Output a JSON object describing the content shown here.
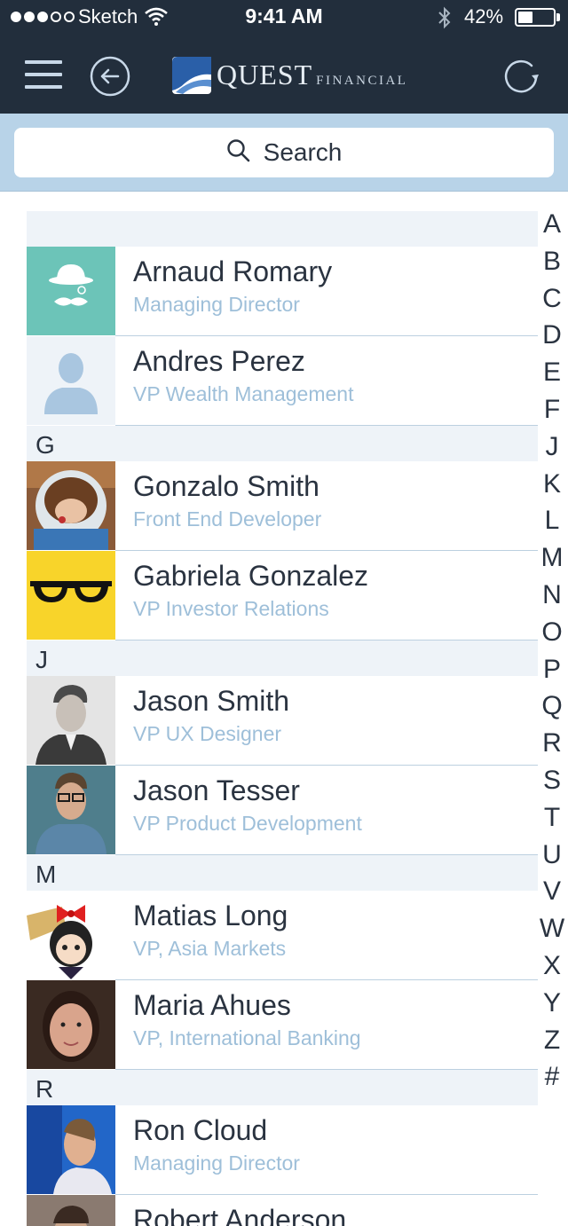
{
  "status_bar": {
    "carrier": "Sketch",
    "time": "9:41 AM",
    "battery_percent": "42%",
    "battery_level": 0.42,
    "signal_bars": 3,
    "signal_total": 5
  },
  "navbar": {
    "brand_name": "QUEST",
    "brand_suffix": "FINANCIAL",
    "menu_icon": "hamburger-menu-icon",
    "back_icon": "back-arrow-circle-icon",
    "refresh_icon": "refresh-icon"
  },
  "search": {
    "label": "Search",
    "icon": "search-icon"
  },
  "colors": {
    "topbar": "#222e3c",
    "search_band": "#b8d3e8",
    "section_header": "#eef3f8",
    "subtitle": "#9ebfd9",
    "text": "#2a3340"
  },
  "contacts": {
    "sections": [
      {
        "letter": "",
        "rows": [
          {
            "name": "Arnaud Romary",
            "title": "Managing Director",
            "avatar": "bowler-hat-mustache-avatar"
          },
          {
            "name": "Andres Perez",
            "title": "VP Wealth Management",
            "avatar": "default-person-avatar"
          }
        ]
      },
      {
        "letter": "G",
        "rows": [
          {
            "name": "Gonzalo Smith",
            "title": "Front End Developer",
            "avatar": "astronaut-helmet-photo"
          },
          {
            "name": "Gabriela Gonzalez",
            "title": "VP Investor Relations",
            "avatar": "black-glasses-avatar"
          }
        ]
      },
      {
        "letter": "J",
        "rows": [
          {
            "name": "Jason Smith",
            "title": "VP UX Designer",
            "avatar": "man-in-suit-photo"
          },
          {
            "name": "Jason Tesser",
            "title": "VP Product Development",
            "avatar": "man-with-glasses-photo"
          }
        ]
      },
      {
        "letter": "M",
        "rows": [
          {
            "name": "Matias Long",
            "title": "VP, Asia Markets",
            "avatar": "anime-girl-red-bow-avatar"
          },
          {
            "name": "Maria Ahues",
            "title": "VP, International Banking",
            "avatar": "woman-portrait-photo"
          }
        ]
      },
      {
        "letter": "R",
        "rows": [
          {
            "name": "Ron Cloud",
            "title": "Managing Director",
            "avatar": "man-speaking-photo"
          },
          {
            "name": "Robert Anderson",
            "title": "",
            "avatar": "man-portrait-photo"
          }
        ]
      }
    ]
  },
  "index_letters": [
    "A",
    "B",
    "C",
    "D",
    "E",
    "F",
    "J",
    "K",
    "L",
    "M",
    "N",
    "O",
    "P",
    "Q",
    "R",
    "S",
    "T",
    "U",
    "V",
    "W",
    "X",
    "Y",
    "Z",
    "#"
  ]
}
